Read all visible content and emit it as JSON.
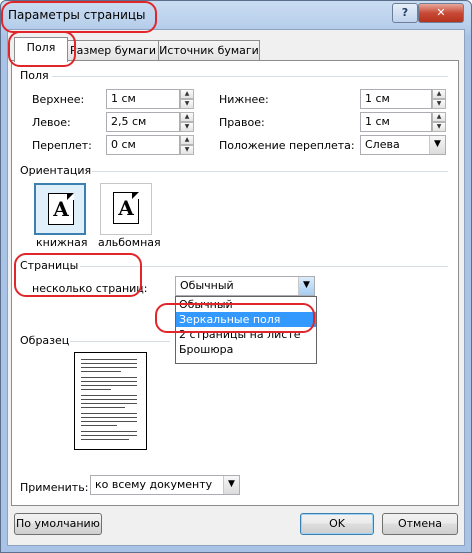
{
  "window": {
    "title": "Параметры страницы",
    "help_label": "?",
    "close_label": "x"
  },
  "tabs": [
    {
      "label": "Поля",
      "active": true
    },
    {
      "label": "Размер бумаги",
      "active": false
    },
    {
      "label": "Источник бумаги",
      "active": false
    }
  ],
  "margins": {
    "group_label": "Поля",
    "top_label": "Верхнее:",
    "top_value": "1 см",
    "bottom_label": "Нижнее:",
    "bottom_value": "1 см",
    "left_label": "Левое:",
    "left_value": "2,5 см",
    "right_label": "Правое:",
    "right_value": "1 см",
    "gutter_label": "Переплет:",
    "gutter_value": "0 см",
    "gutter_pos_label": "Положение переплета:",
    "gutter_pos_value": "Слева"
  },
  "orientation": {
    "group_label": "Ориентация",
    "portrait_label": "книжная",
    "landscape_label": "альбомная",
    "icon_letter": "A",
    "selected": "portrait"
  },
  "pages": {
    "group_label": "Страницы",
    "multiple_label": "несколько страниц:",
    "selected_value": "Обычный",
    "options": [
      "Обычный",
      "Зеркальные поля",
      "2 страницы на листе",
      "Брошюра"
    ],
    "highlighted_index": 1
  },
  "preview": {
    "group_label": "Образец"
  },
  "apply": {
    "label": "Применить:",
    "value": "ко всему документу"
  },
  "buttons": {
    "default_label": "По умолчанию",
    "ok_label": "OK",
    "cancel_label": "Отмена"
  },
  "colors": {
    "highlight": "#3399ff",
    "annotation": "#e0262b",
    "selected_orientation": "#dff0fb"
  }
}
